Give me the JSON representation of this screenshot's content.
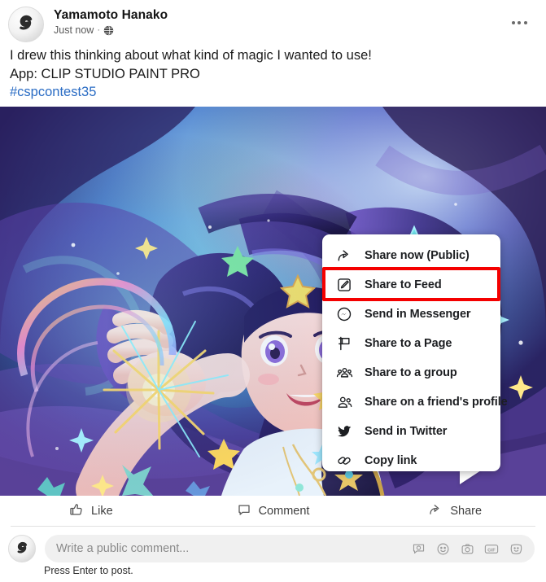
{
  "post": {
    "author": "Yamamoto Hanako",
    "timestamp": "Just now",
    "separator": "·",
    "privacy_icon": "globe-icon",
    "avatar_icon": "clip-studio-paint-logo",
    "more_button_label": "…",
    "text_line_1": "I drew this thinking about what kind of magic I wanted to use!",
    "text_line_2": "App: CLIP STUDIO PAINT PRO",
    "hashtag": "#cspcontest35",
    "hashtag_color": "#2a6cc4"
  },
  "media": {
    "alt": "Fantasy illustration of a smiling girl with long flowing purple-blue hair, casting sparkling magic from her open hand, surrounded by colorful stars"
  },
  "share_menu": {
    "highlight_color": "#f40000",
    "highlighted_index": 1,
    "items": [
      {
        "label": "Share now (Public)",
        "icon": "share-arrow-icon"
      },
      {
        "label": "Share to Feed",
        "icon": "pencil-square-icon"
      },
      {
        "label": "Send in Messenger",
        "icon": "messenger-icon"
      },
      {
        "label": "Share to a Page",
        "icon": "flag-page-icon"
      },
      {
        "label": "Share to a group",
        "icon": "group-icon"
      },
      {
        "label": "Share on a friend's profile",
        "icon": "friends-icon"
      },
      {
        "label": "Send in Twitter",
        "icon": "twitter-bird-icon"
      },
      {
        "label": "Copy link",
        "icon": "link-chain-icon"
      }
    ]
  },
  "actions": [
    {
      "label": "Like",
      "icon": "thumbs-up-icon"
    },
    {
      "label": "Comment",
      "icon": "comment-bubble-icon"
    },
    {
      "label": "Share",
      "icon": "share-arrow-icon"
    }
  ],
  "composer": {
    "avatar_icon": "clip-studio-paint-logo",
    "placeholder": "Write a public comment...",
    "hint": "Press Enter to post.",
    "icons": [
      {
        "name": "comment-sticker-icon"
      },
      {
        "name": "emoji-smiley-icon"
      },
      {
        "name": "camera-icon"
      },
      {
        "name": "gif-icon"
      },
      {
        "name": "sticker-face-icon"
      }
    ]
  }
}
